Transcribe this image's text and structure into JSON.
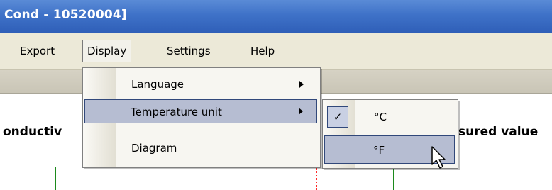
{
  "window": {
    "title": "Cond - 10520004]"
  },
  "menubar": {
    "items": [
      {
        "label": "Export"
      },
      {
        "label": "Display"
      },
      {
        "label": "Settings"
      },
      {
        "label": "Help"
      }
    ],
    "open_item": "Display"
  },
  "content": {
    "left_label": "onductiv",
    "right_label": "sured value"
  },
  "display_menu": {
    "items": [
      {
        "label": "Language",
        "has_submenu": true
      },
      {
        "label": "Temperature unit",
        "has_submenu": true,
        "highlighted": true
      },
      {
        "label": "Diagram",
        "has_submenu": false
      }
    ]
  },
  "temperature_submenu": {
    "items": [
      {
        "label": "°C",
        "checked": true,
        "check_glyph": "✓"
      },
      {
        "label": "°F",
        "checked": false,
        "hovered": true
      }
    ]
  },
  "colors": {
    "titlebar": "#3f72c8",
    "menu_highlight": "#b6bdd2",
    "highlight_border": "#31487a",
    "grid_green": "#1c8a1c",
    "marker_red": "#ff2a2a"
  },
  "icons": {
    "cursor": "arrow-cursor-icon",
    "submenu_arrow": "chevron-right-icon",
    "check": "check-icon"
  }
}
